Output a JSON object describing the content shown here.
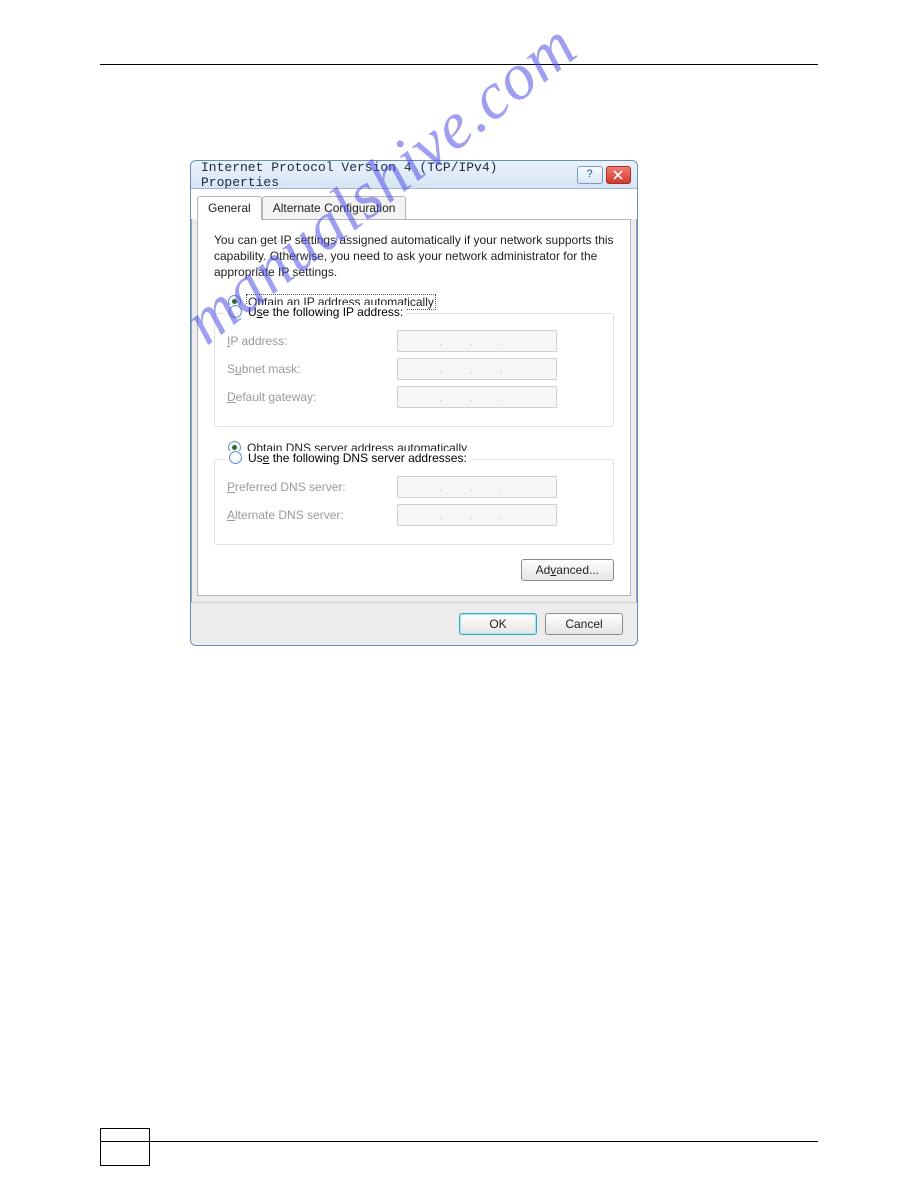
{
  "watermark": "manualshive.com",
  "dialog": {
    "title": "Internet Protocol Version 4 (TCP/IPv4) Properties",
    "tabs": {
      "general": "General",
      "alternate": "Alternate Configuration"
    },
    "description": "You can get IP settings assigned automatically if your network supports this capability. Otherwise, you need to ask your network administrator for the appropriate IP settings.",
    "ip_section": {
      "auto_label": "Obtain an IP address automatically",
      "auto_hotkey": "O",
      "manual_label": "Use the following IP address:",
      "manual_hotkey": "S",
      "fields": {
        "ip_address": "IP address:",
        "ip_address_hotkey": "I",
        "subnet_mask": "Subnet mask:",
        "subnet_mask_hotkey": "u",
        "default_gateway": "Default gateway:",
        "default_gateway_hotkey": "D"
      },
      "selected": "auto"
    },
    "dns_section": {
      "auto_label": "Obtain DNS server address automatically",
      "auto_hotkey": "b",
      "manual_label": "Use the following DNS server addresses:",
      "manual_hotkey": "e",
      "fields": {
        "preferred": "Preferred DNS server:",
        "preferred_hotkey": "P",
        "alternate": "Alternate DNS server:",
        "alternate_hotkey": "A"
      },
      "selected": "auto"
    },
    "ip_dots": ".   .   .",
    "advanced_label": "Advanced...",
    "advanced_hotkey": "V",
    "ok_label": "OK",
    "cancel_label": "Cancel"
  }
}
